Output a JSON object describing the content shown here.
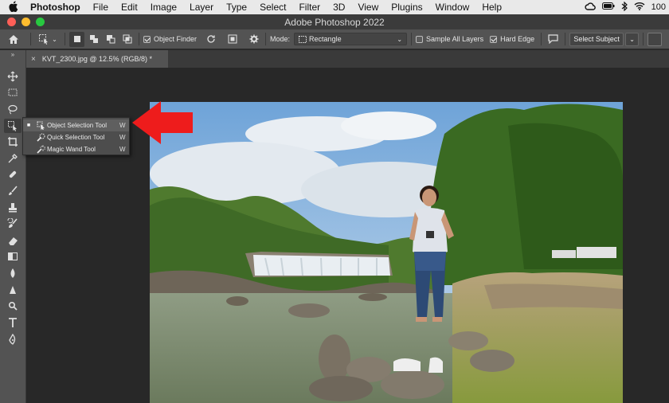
{
  "menubar": {
    "app": "Photoshop",
    "items": [
      "File",
      "Edit",
      "Image",
      "Layer",
      "Type",
      "Select",
      "Filter",
      "3D",
      "View",
      "Plugins",
      "Window",
      "Help"
    ],
    "status": {
      "battery_pct": "100"
    }
  },
  "window": {
    "title": "Adobe Photoshop 2022"
  },
  "options_bar": {
    "object_finder_label": "Object Finder",
    "object_finder_checked": true,
    "mode_label": "Mode:",
    "mode_value": "Rectangle",
    "sample_all_layers_label": "Sample All Layers",
    "sample_all_layers_checked": false,
    "hard_edge_label": "Hard Edge",
    "hard_edge_checked": true,
    "select_subject_label": "Select Subject"
  },
  "document": {
    "tab_title": "KVT_2300.jpg @ 12.5% (RGB/8) *"
  },
  "flyout": {
    "items": [
      {
        "label": "Object Selection Tool",
        "shortcut": "W",
        "icon": "object-selection-icon",
        "selected": true
      },
      {
        "label": "Quick Selection Tool",
        "shortcut": "W",
        "icon": "quick-selection-icon",
        "selected": false
      },
      {
        "label": "Magic Wand Tool",
        "shortcut": "W",
        "icon": "magic-wand-icon",
        "selected": false
      }
    ]
  },
  "toolbar": {
    "collapse": "»",
    "tools": [
      "move-icon",
      "marquee-icon",
      "lasso-icon",
      "object-selection-icon",
      "crop-icon",
      "eyedropper-icon",
      "healing-brush-icon",
      "brush-icon",
      "clone-stamp-icon",
      "history-brush-icon",
      "eraser-icon",
      "gradient-icon",
      "blur-icon",
      "dodge-icon",
      "pen-icon",
      "type-icon",
      "path-selection-icon"
    ]
  },
  "colors": {
    "annotation_arrow": "#ee1c1c",
    "ui_dark": "#535353",
    "canvas_bg": "#282828"
  }
}
